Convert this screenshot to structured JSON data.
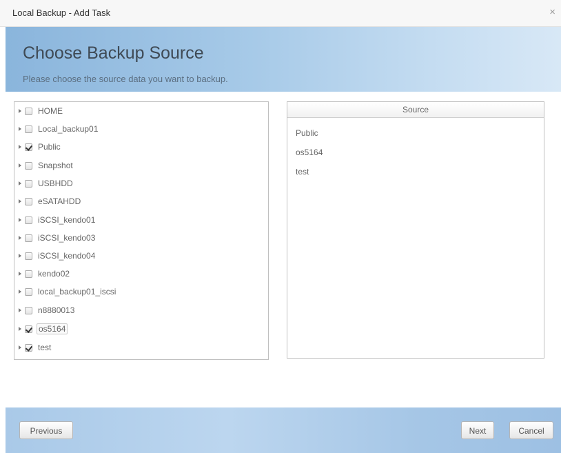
{
  "window": {
    "title": "Local Backup - Add Task",
    "close_glyph": "×"
  },
  "header": {
    "title": "Choose Backup Source",
    "subtitle": "Please choose the source data you want to backup."
  },
  "tree": {
    "items": [
      {
        "label": "HOME",
        "checked": false
      },
      {
        "label": "Local_backup01",
        "checked": false
      },
      {
        "label": "Public",
        "checked": true
      },
      {
        "label": "Snapshot",
        "checked": false
      },
      {
        "label": "USBHDD",
        "checked": false
      },
      {
        "label": "eSATAHDD",
        "checked": false
      },
      {
        "label": "iSCSI_kendo01",
        "checked": false
      },
      {
        "label": "iSCSI_kendo03",
        "checked": false
      },
      {
        "label": "iSCSI_kendo04",
        "checked": false
      },
      {
        "label": "kendo02",
        "checked": false
      },
      {
        "label": "local_backup01_iscsi",
        "checked": false
      },
      {
        "label": "n8880013",
        "checked": false
      },
      {
        "label": "os5164",
        "checked": true,
        "selected": true
      },
      {
        "label": "test",
        "checked": true
      }
    ]
  },
  "source": {
    "header": "Source",
    "items": [
      "Public",
      "os5164",
      "test"
    ]
  },
  "footer": {
    "previous_label": "Previous",
    "next_label": "Next",
    "cancel_label": "Cancel"
  },
  "colors": {
    "header_gradient_start": "#8ab5dc",
    "header_gradient_end": "#d8e8f6",
    "footer_color": "#bcd6ef"
  }
}
